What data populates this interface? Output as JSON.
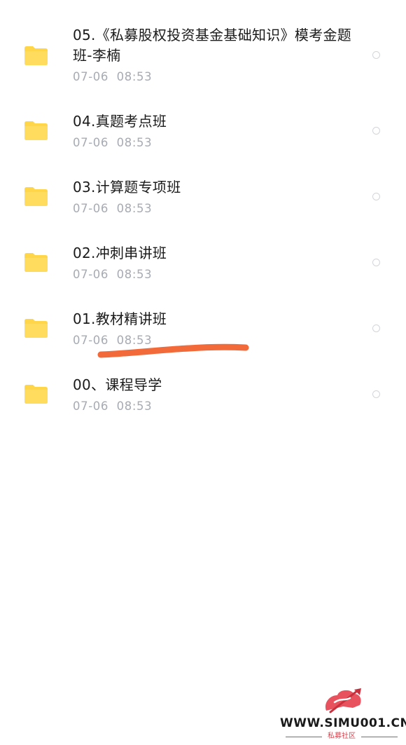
{
  "folders": [
    {
      "title": "05.《私募股权投资基金基础知识》模考金题班-李楠",
      "date": "07-06  08:53",
      "icon": "folder-icon"
    },
    {
      "title": "04.真题考点班",
      "date": "07-06  08:53",
      "icon": "folder-icon"
    },
    {
      "title": "03.计算题专项班",
      "date": "07-06  08:53",
      "icon": "folder-icon"
    },
    {
      "title": "02.冲刺串讲班",
      "date": "07-06  08:53",
      "icon": "folder-icon"
    },
    {
      "title": "01.教材精讲班",
      "date": "07-06  08:53",
      "icon": "folder-icon"
    },
    {
      "title": "00、课程导学",
      "date": "07-06  08:53",
      "icon": "folder-icon"
    }
  ],
  "watermark": {
    "url": "WWW.SIMU001.CN",
    "subtitle": "私募社区",
    "logo": "sword-logo-icon"
  },
  "colors": {
    "folder": "#ffd54a",
    "annotation_stroke": "#f26a3a",
    "date_text": "#a7abb3",
    "watermark_red": "#d9434f"
  }
}
